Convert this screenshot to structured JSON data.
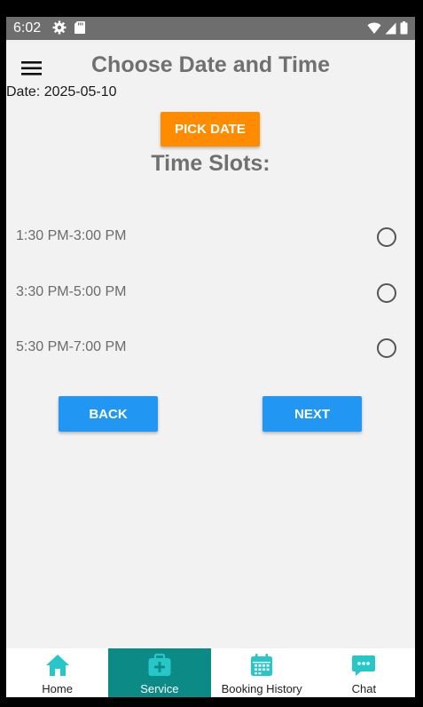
{
  "status_bar": {
    "time": "6:02",
    "left_icons": [
      "gear-icon",
      "sd-card-icon"
    ],
    "right_icons": [
      "wifi-icon",
      "signal-icon",
      "battery-icon"
    ]
  },
  "header": {
    "title": "Choose Date and Time",
    "menu_icon": "hamburger-menu-icon"
  },
  "date": {
    "label": "Date: 2025-05-10"
  },
  "pick_date_button": {
    "label": "PICK DATE",
    "color": "#ff8c00"
  },
  "time_slots": {
    "title": "Time Slots:",
    "slots": [
      {
        "label": "1:30 PM-3:00 PM",
        "selected": false
      },
      {
        "label": "3:30 PM-5:00 PM",
        "selected": false
      },
      {
        "label": "5:30 PM-7:00 PM",
        "selected": false
      }
    ]
  },
  "buttons": {
    "back": "BACK",
    "next": "NEXT",
    "color": "#2196f3"
  },
  "bottom_nav": {
    "active_color": "#0b8a86",
    "icon_color": "#26c6c9",
    "items": [
      {
        "label": "Home",
        "icon": "home-icon",
        "active": false
      },
      {
        "label": "Service",
        "icon": "medical-kit-icon",
        "active": true
      },
      {
        "label": "Booking History",
        "icon": "calendar-icon",
        "active": false
      },
      {
        "label": "Chat",
        "icon": "chat-bubble-icon",
        "active": false
      }
    ]
  }
}
